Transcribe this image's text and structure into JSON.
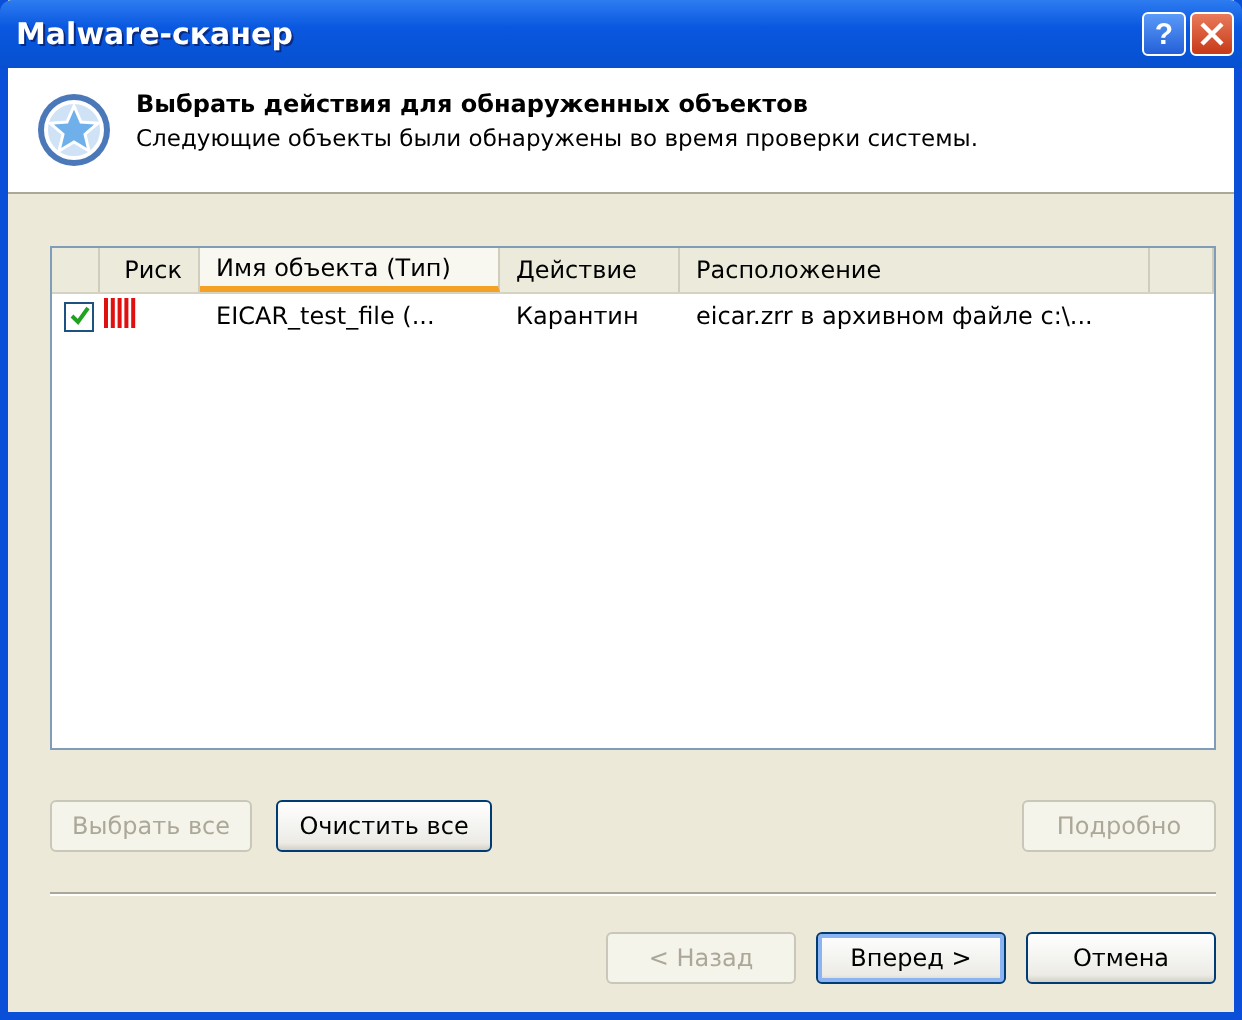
{
  "window": {
    "title": "Malware-сканер",
    "help_button": "?"
  },
  "header": {
    "title": "Выбрать действия для обнаруженных объектов",
    "subtitle": "Следующие объекты были обнаружены во время проверки системы."
  },
  "table": {
    "columns": [
      {
        "label": "Риск",
        "sorted": false
      },
      {
        "label": "Имя объекта (Тип)",
        "sorted": true
      },
      {
        "label": "Действие",
        "sorted": false
      },
      {
        "label": "Расположение",
        "sorted": false
      }
    ],
    "rows": [
      {
        "checked": true,
        "name": "EICAR_test_file (...",
        "action": "Карантин",
        "location": "eicar.zrr в архивном файле c:\\..."
      }
    ]
  },
  "list_buttons": [
    {
      "label": "Выбрать все",
      "disabled": true
    },
    {
      "label": "Очистить все",
      "disabled": false
    },
    {
      "label": "Подробно",
      "disabled": true
    }
  ],
  "nav_buttons": [
    {
      "label": "< Назад",
      "disabled": true,
      "default": false
    },
    {
      "label": "Вперед >",
      "disabled": false,
      "default": true
    },
    {
      "label": "Отмена",
      "disabled": false,
      "default": false
    }
  ]
}
